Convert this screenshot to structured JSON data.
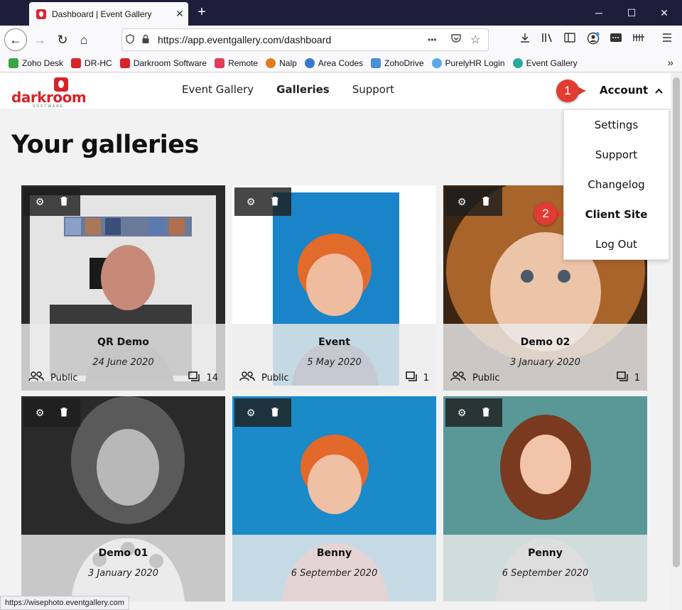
{
  "browser": {
    "tab_title": "Dashboard | Event Gallery",
    "tab_close": "✕",
    "new_tab": "+",
    "win_min": "─",
    "win_max": "☐",
    "win_close": "✕",
    "url": "https://app.eventgallery.com/dashboard",
    "back_icon": "←",
    "forward_icon": "→",
    "reload_icon": "↻",
    "home_icon": "⌂",
    "more_icon": "•••",
    "bookmarks": [
      {
        "label": "Zoho Desk",
        "color": "#3aa646"
      },
      {
        "label": "DR-HC",
        "color": "#d8232a"
      },
      {
        "label": "Darkroom Software",
        "color": "#d8232a"
      },
      {
        "label": "Remote",
        "color": "#e23c5a"
      },
      {
        "label": "Nalp",
        "color": "#e07b1e"
      },
      {
        "label": "Area Codes",
        "color": "#3a78c9"
      },
      {
        "label": "ZohoDrive",
        "color": "#4a8fd8"
      },
      {
        "label": "PurelyHR Login",
        "color": "#5aa9e6"
      },
      {
        "label": "Event Gallery",
        "color": "#2ba8a0"
      }
    ],
    "bookmarks_more": "»",
    "status_url": "https://wisephoto.eventgallery.com"
  },
  "header": {
    "logo_text": "darkroom",
    "logo_sub": "SOFTWARE",
    "nav": [
      "Event Gallery",
      "Galleries",
      "Support"
    ],
    "account_label": "Account",
    "account_caret": "⌃"
  },
  "page": {
    "title": "Your galleries"
  },
  "account_menu": [
    "Settings",
    "Support",
    "Changelog",
    "Client Site",
    "Log Out"
  ],
  "callouts": [
    "1",
    "2"
  ],
  "galleries": [
    {
      "name": "QR Demo",
      "date": "24 June 2020",
      "visibility": "Public",
      "count": "14"
    },
    {
      "name": "Event",
      "date": "5 May 2020",
      "visibility": "Public",
      "count": "1"
    },
    {
      "name": "Demo 02",
      "date": "3 January 2020",
      "visibility": "Public",
      "count": "1"
    },
    {
      "name": "Demo 01",
      "date": "3 January 2020"
    },
    {
      "name": "Benny",
      "date": "6 September 2020"
    },
    {
      "name": "Penny",
      "date": "6 September 2020"
    }
  ],
  "colors": {
    "brand_red": "#d8232a",
    "callout_red": "#e23c32",
    "chrome_dark": "#1f1e3a"
  }
}
